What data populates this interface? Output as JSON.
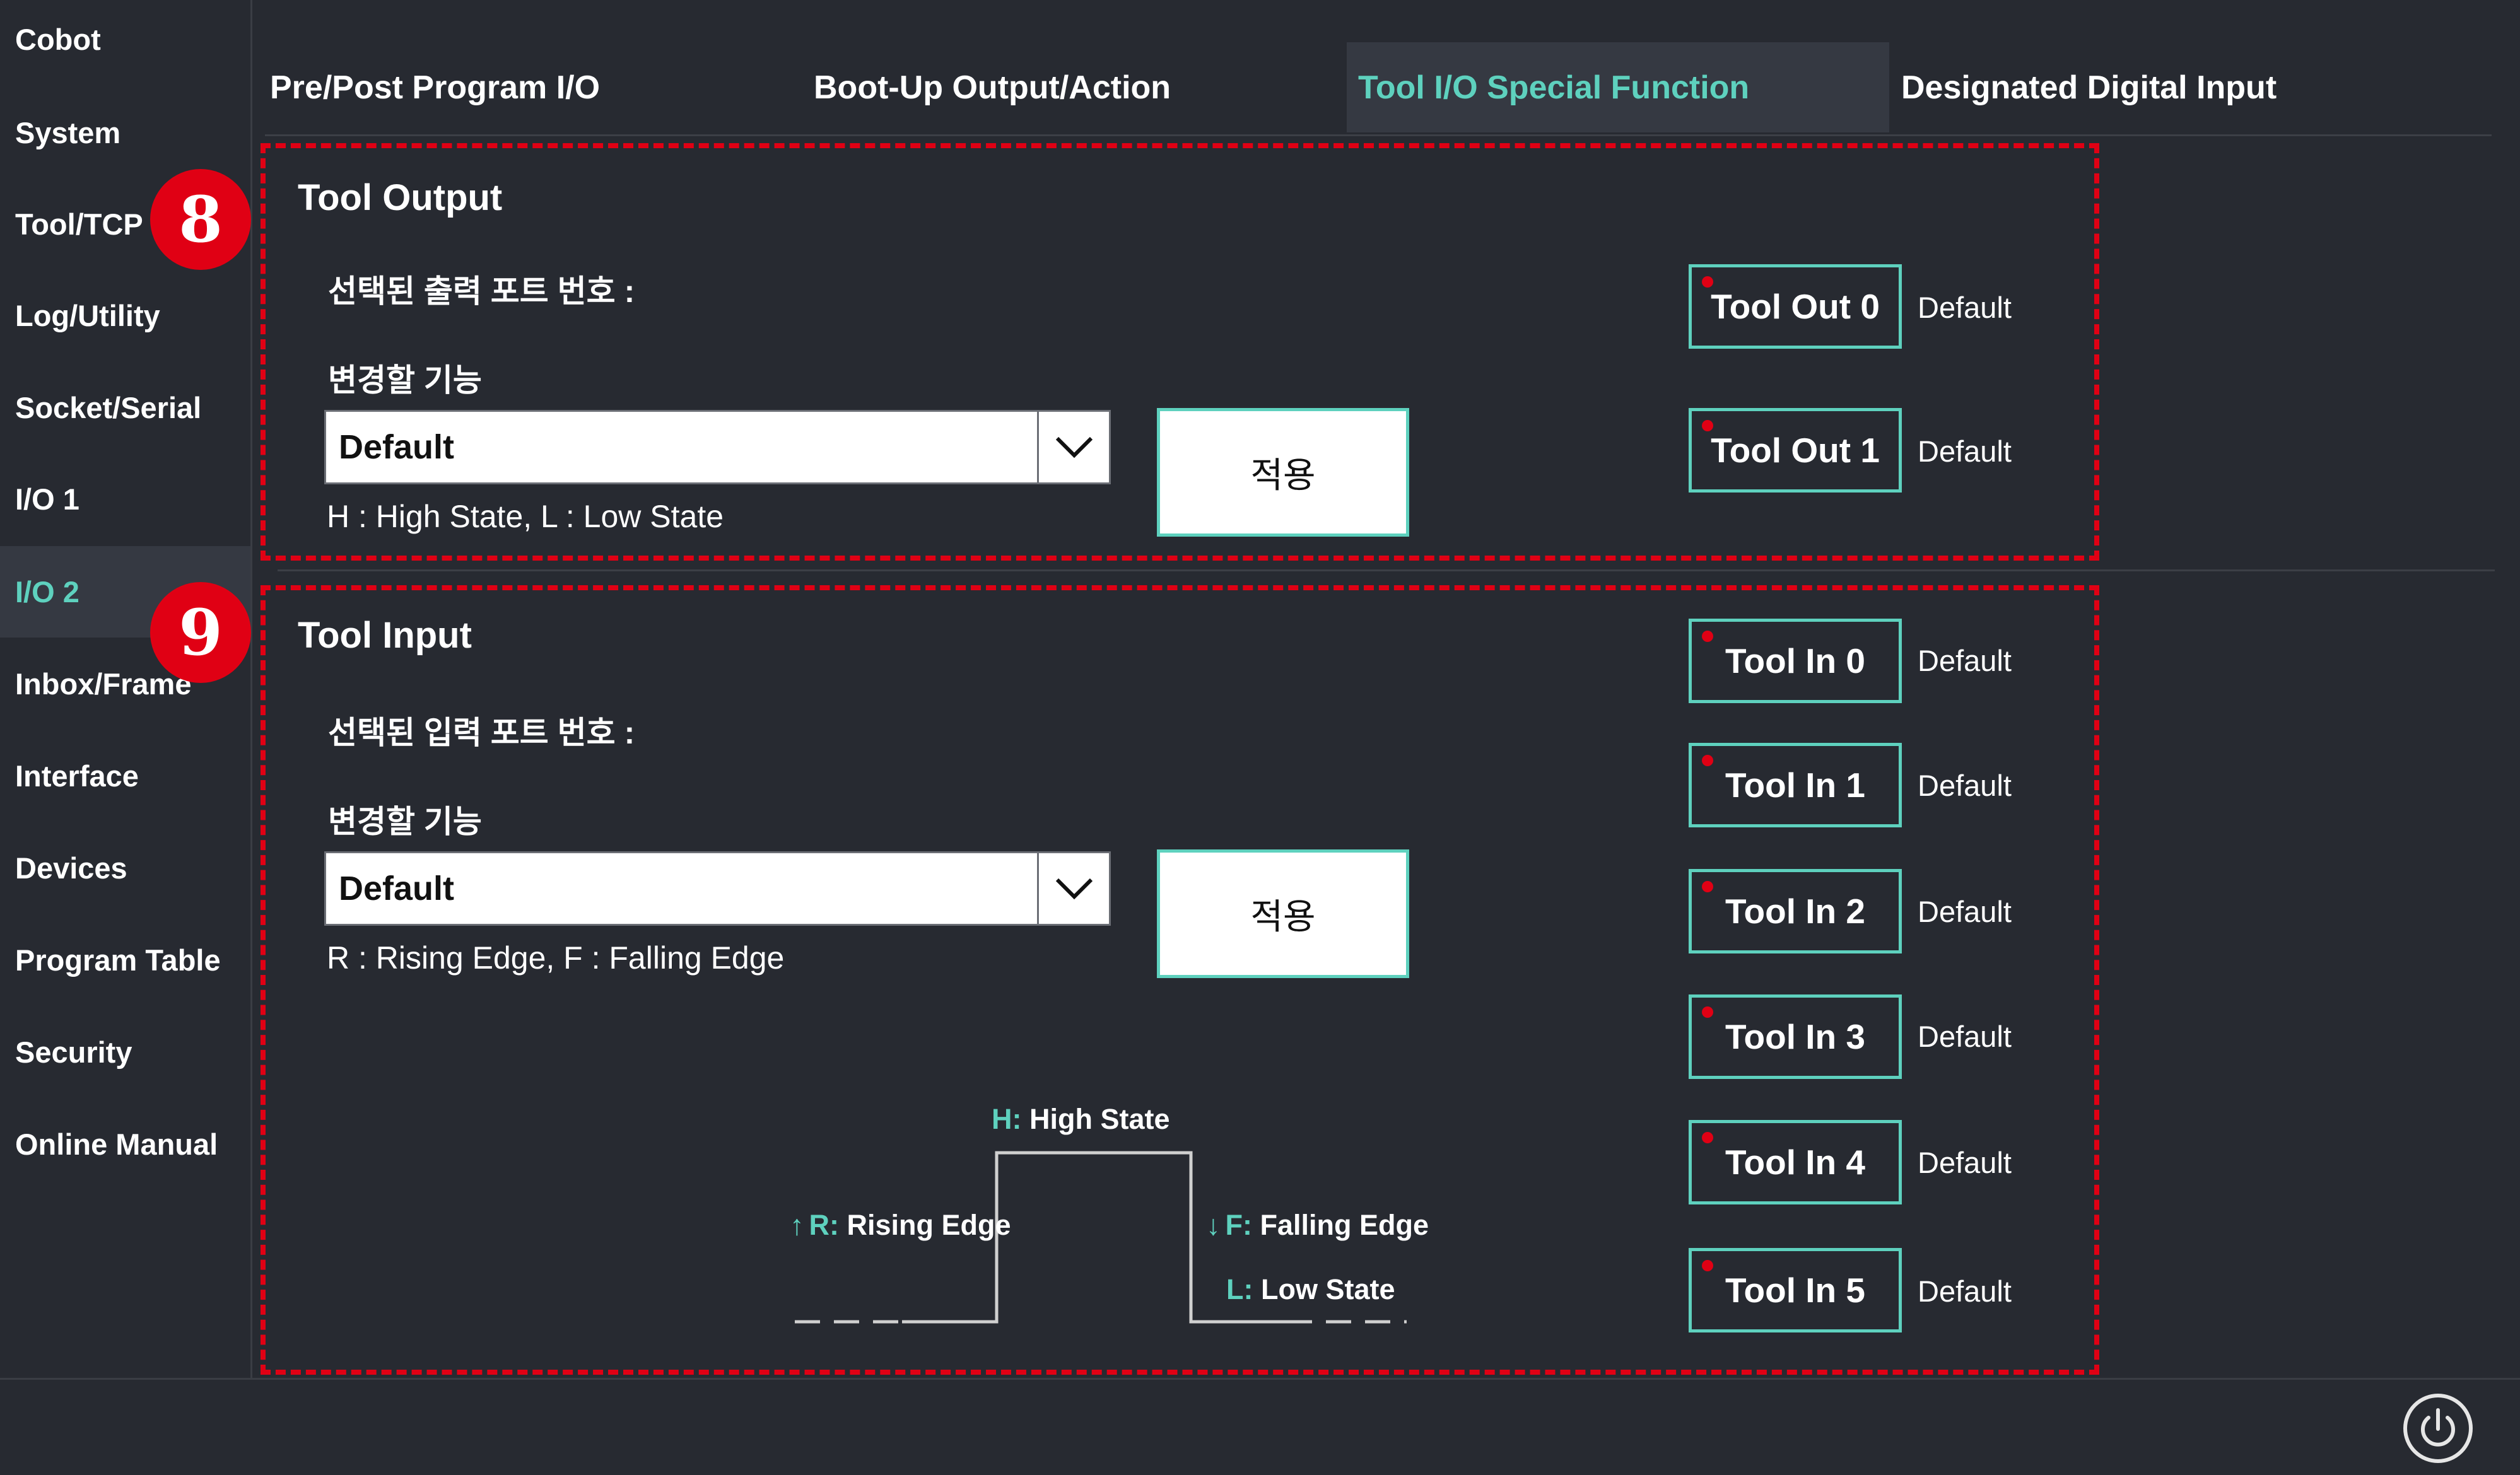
{
  "sidebar": {
    "items": [
      {
        "label": "Cobot"
      },
      {
        "label": "System"
      },
      {
        "label": "Tool/TCP"
      },
      {
        "label": "Log/Utility"
      },
      {
        "label": "Socket/Serial"
      },
      {
        "label": "I/O 1"
      },
      {
        "label": "I/O 2",
        "active": true
      },
      {
        "label": "Inbox/Frame"
      },
      {
        "label": "Interface"
      },
      {
        "label": "Devices"
      },
      {
        "label": "Program Table"
      },
      {
        "label": "Security"
      },
      {
        "label": "Online Manual"
      }
    ]
  },
  "tabs": [
    {
      "label": "Pre/Post Program I/O"
    },
    {
      "label": "Boot-Up Output/Action"
    },
    {
      "label": "Tool I/O Special Function",
      "active": true
    },
    {
      "label": "Designated Digital Input"
    }
  ],
  "badges": {
    "tool_output": "8",
    "tool_input": "9"
  },
  "tool_output": {
    "title": "Tool Output",
    "selected_port_label": "선택된 출력 포트 번호 :",
    "change_function_label": "변경할 기능",
    "select_value": "Default",
    "apply_label": "적용",
    "hint": "H : High State, L : Low State",
    "ports": [
      {
        "label": "Tool Out 0",
        "status": "Default"
      },
      {
        "label": "Tool Out 1",
        "status": "Default"
      }
    ]
  },
  "tool_input": {
    "title": "Tool Input",
    "selected_port_label": "선택된 입력 포트 번호 :",
    "change_function_label": "변경할 기능",
    "select_value": "Default",
    "apply_label": "적용",
    "hint": "R : Rising Edge, F : Falling Edge",
    "ports": [
      {
        "label": "Tool In 0",
        "status": "Default"
      },
      {
        "label": "Tool In 1",
        "status": "Default"
      },
      {
        "label": "Tool In 2",
        "status": "Default"
      },
      {
        "label": "Tool In 3",
        "status": "Default"
      },
      {
        "label": "Tool In 4",
        "status": "Default"
      },
      {
        "label": "Tool In 5",
        "status": "Default"
      }
    ]
  },
  "diagram": {
    "high_prefix": "H:",
    "high_text": " High State",
    "rising_arrow": "↑",
    "rising_prefix": "R:",
    "rising_text": " Rising Edge",
    "falling_arrow": "↓",
    "falling_prefix": "F:",
    "falling_text": " Falling Edge",
    "low_prefix": "L:",
    "low_text": " Low State"
  },
  "colors": {
    "accent": "#5ed1be",
    "highlight": "#e00014",
    "background": "#272a31",
    "active_bg": "#353942"
  },
  "icons": {
    "dropdown": "chevron-down-icon",
    "power": "power-icon",
    "status": "status-dot-icon"
  }
}
